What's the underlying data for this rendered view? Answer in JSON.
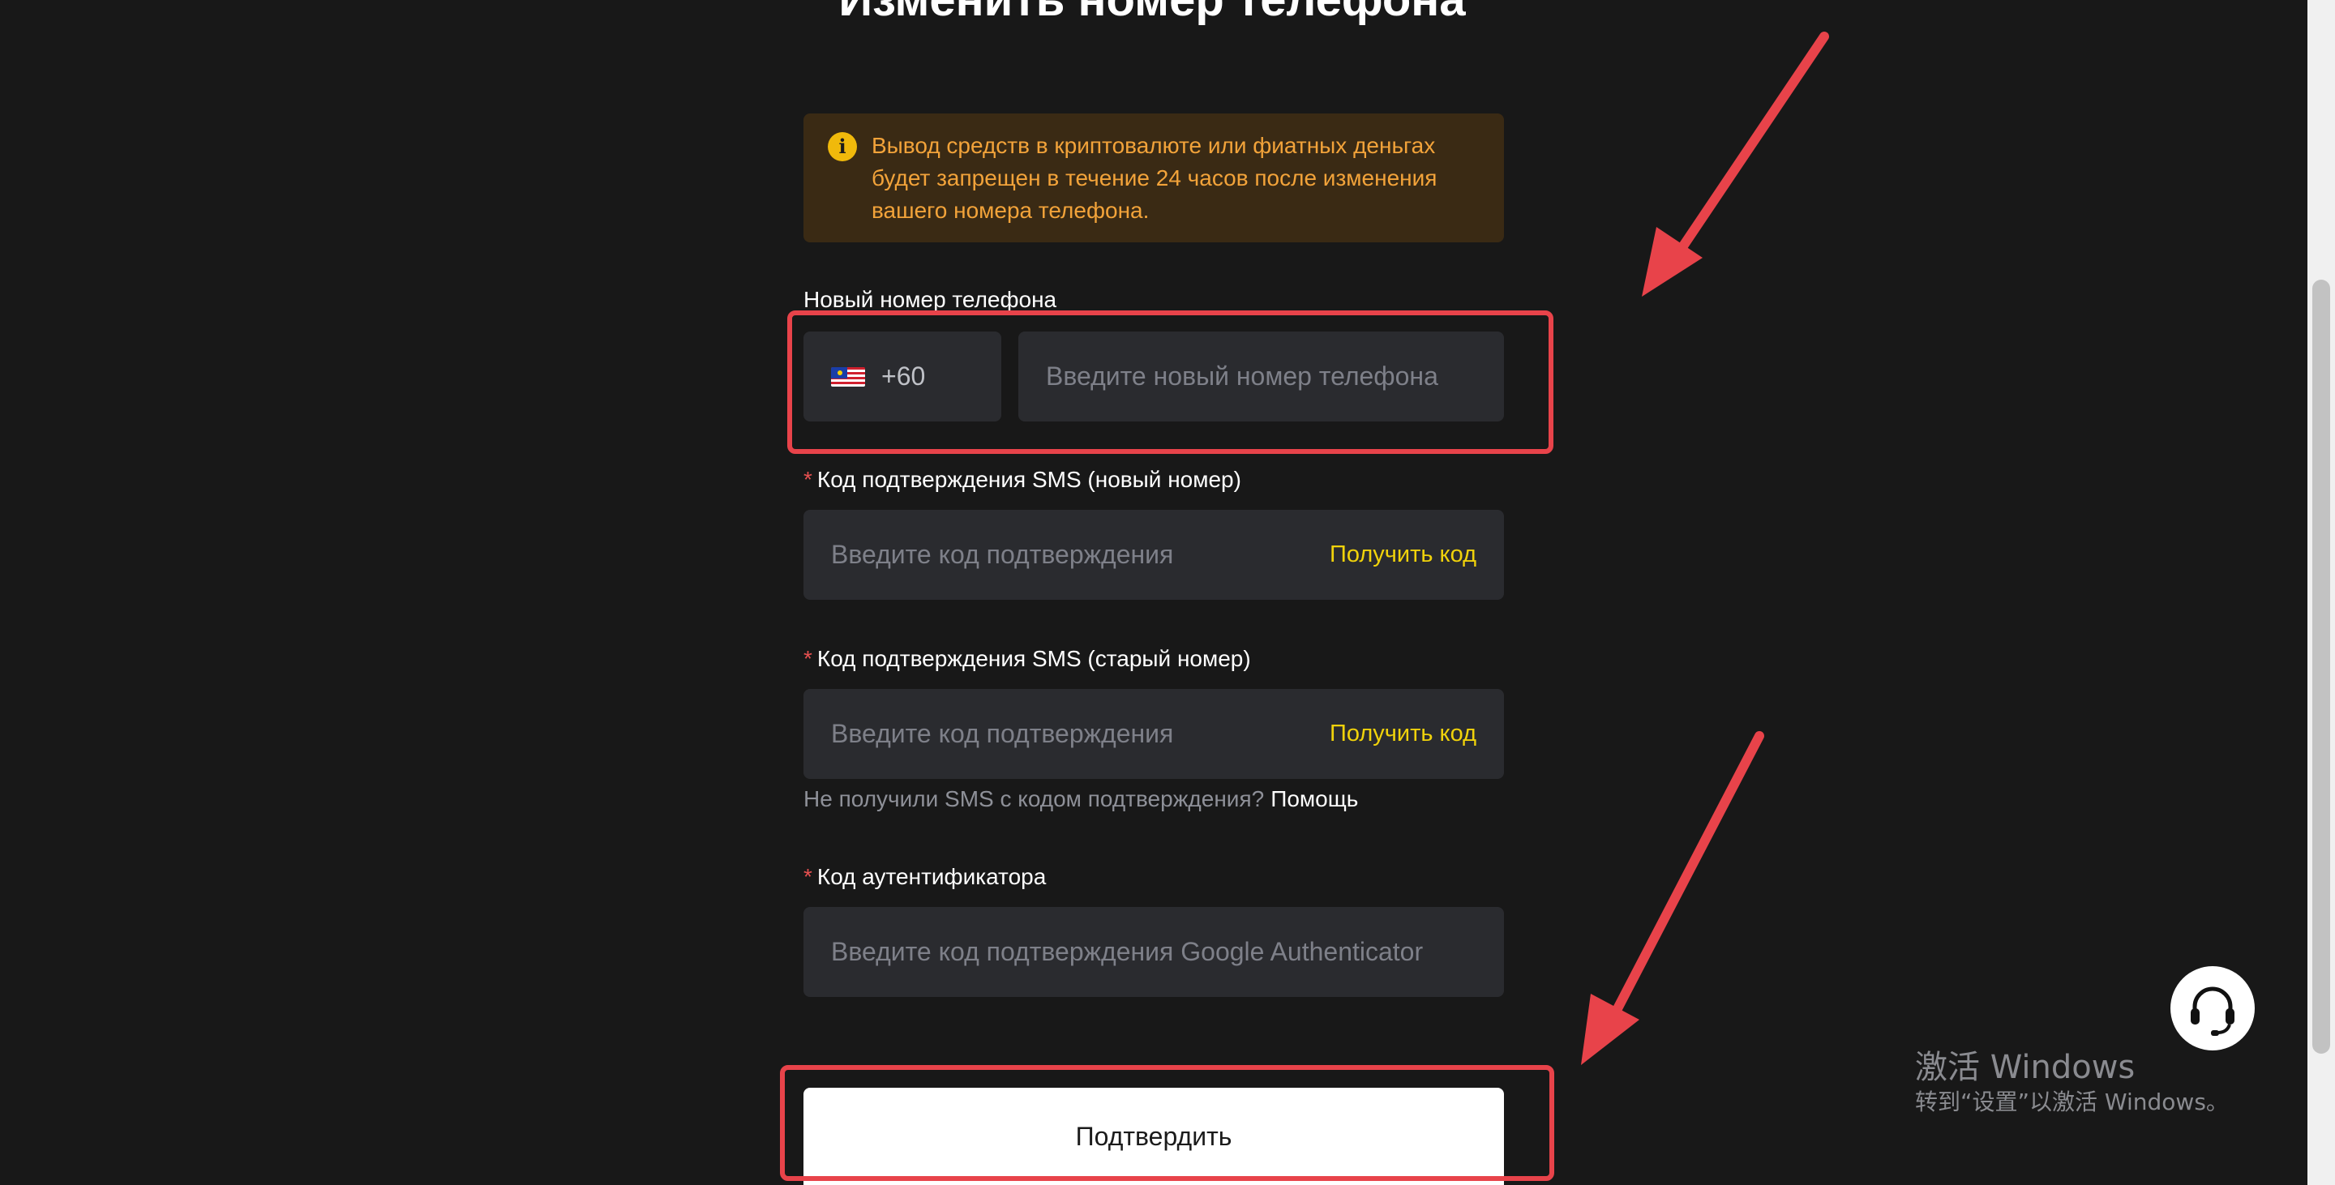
{
  "page": {
    "title": "Изменить номер телефона"
  },
  "warning": {
    "icon": "info-icon",
    "text": "Вывод средств в криптовалюте или фиатных деньгах будет запрещен в течение 24 часов после изменения вашего номера телефона."
  },
  "phone": {
    "label": "Новый номер телефона",
    "country_code": "+60",
    "country_flag": "malaysia-flag-icon",
    "placeholder": "Введите новый номер телефона"
  },
  "sms_new": {
    "required_mark": "*",
    "label": "Код подтверждения SMS (новый номер)",
    "placeholder": "Введите код подтверждения",
    "action": "Получить код"
  },
  "sms_old": {
    "required_mark": "*",
    "label": "Код подтверждения SMS (старый номер)",
    "placeholder": "Введите код подтверждения",
    "action": "Получить код"
  },
  "help": {
    "text": "Не получили SMS с кодом подтверждения?",
    "link": "Помощь"
  },
  "authenticator": {
    "required_mark": "*",
    "label": "Код аутентификатора",
    "placeholder": "Введите код подтверждения Google Authenticator"
  },
  "submit": {
    "label": "Подтвердить"
  },
  "support": {
    "icon": "headset-icon"
  },
  "watermark": {
    "title": "激活 Windows",
    "subtitle": "转到“设置”以激活 Windows。"
  },
  "colors": {
    "background": "#181818",
    "input_bg": "#2a2b2f",
    "accent_yellow": "#f0d20b",
    "warning_text": "#f2a33a",
    "warning_bg": "#3a2a14",
    "annotation_red": "#e8434a",
    "required_red": "#e65050"
  }
}
